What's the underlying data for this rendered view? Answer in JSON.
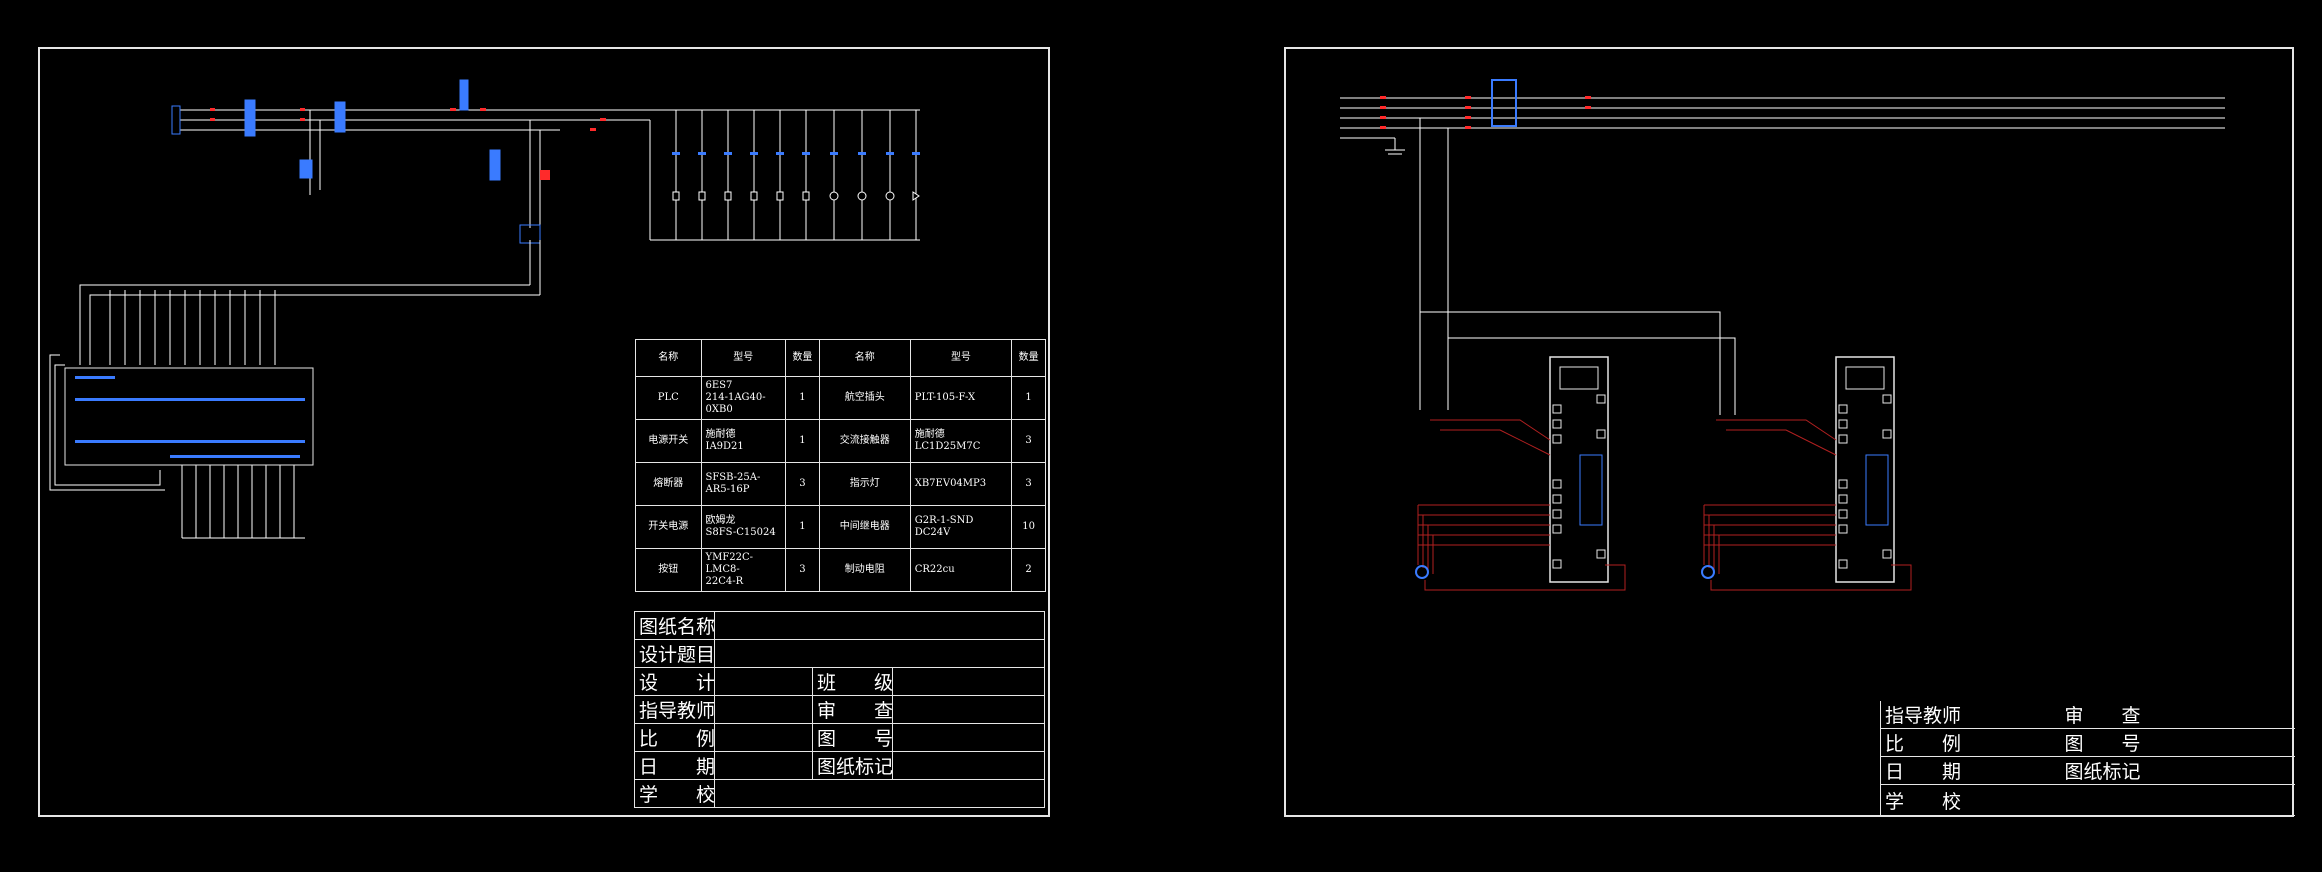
{
  "bom": {
    "headers": [
      "名称",
      "型号",
      "数量",
      "名称",
      "型号",
      "数量"
    ],
    "rows": [
      {
        "name1": "PLC",
        "model1": "6ES7\n214-1AG40-0XB0",
        "qty1": "1",
        "name2": "航空插头",
        "model2": "PLT-105-F-X",
        "qty2": "1"
      },
      {
        "name1": "电源开关",
        "model1": "施耐德\nIA9D21",
        "qty1": "1",
        "name2": "交流接触器",
        "model2": "施耐德\nLC1D25M7C",
        "qty2": "3"
      },
      {
        "name1": "熔断器",
        "model1": "SFSB-25A-AR5-16P",
        "qty1": "3",
        "name2": "指示灯",
        "model2": "XB7EV04MP3",
        "qty2": "3"
      },
      {
        "name1": "开关电源",
        "model1": "欧姆龙\nS8FS-C15024",
        "qty1": "1",
        "name2": "中间继电器",
        "model2": "G2R-1-SND\nDC24V",
        "qty2": "10"
      },
      {
        "name1": "按钮",
        "model1": "YMF22C-LMC8-\n22C4-R",
        "qty1": "3",
        "name2": "制动电阻",
        "model2": "CR22cu",
        "qty2": "2"
      }
    ]
  },
  "title_block_left": {
    "drawing_name": "图纸名称",
    "design_topic": "设计题目",
    "design": "设　　计",
    "class": "班　　级",
    "instructor": "指导教师",
    "review": "审　　查",
    "scale": "比　　例",
    "drawing_no": "图　　号",
    "date": "日　　期",
    "drawing_mark": "图纸标记",
    "school": "学　　校"
  },
  "title_block_right": {
    "instructor": "指导教师",
    "review": "审　　查",
    "scale": "比　　例",
    "drawing_no": "图　　号",
    "date": "日　　期",
    "drawing_mark": "图纸标记",
    "school": "学　　校"
  },
  "colors": {
    "frame": "#e6e6e6",
    "wire": "#ffffff",
    "wire_red": "#ff2a2a",
    "wire_darkred": "#b22020",
    "component": "#3a7bff",
    "label_green": "#33ff33"
  }
}
